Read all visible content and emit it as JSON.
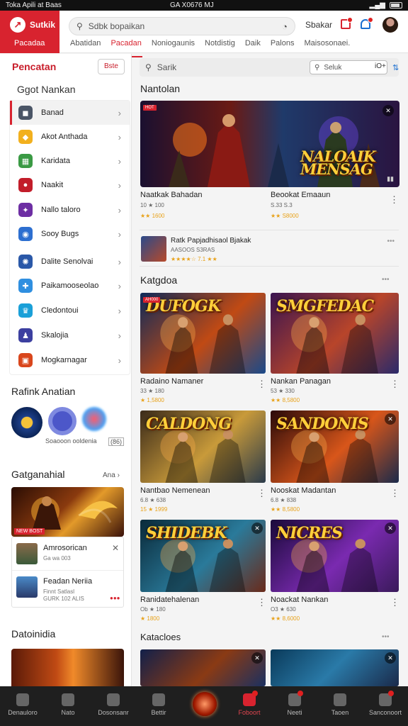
{
  "status": {
    "left": "Toka Apili at Baas",
    "center": "GA X0676 MJ",
    "right": "ML"
  },
  "header": {
    "brand": "Sutkik",
    "brand_sub": "Pacadaa",
    "search": "Sdbk bopaikan",
    "link": "Sbakar",
    "tabs": [
      "Abatidan",
      "Pacadan",
      "Noniogaunis",
      "Notdistig",
      "Daik",
      "Palons",
      "Maisosonaei."
    ]
  },
  "sidebar": {
    "title": "Pencatan",
    "button": "Bste",
    "section": "Ggot Nankan",
    "items": [
      {
        "label": "Banad",
        "color": "#4a5566",
        "icon": "◼"
      },
      {
        "label": "Akot Anthada",
        "color": "#f2b01e",
        "icon": "◆"
      },
      {
        "label": "Karidata",
        "color": "#3a9a44",
        "icon": "▦"
      },
      {
        "label": "Naakit",
        "color": "#c21d2a",
        "icon": "●"
      },
      {
        "label": "Nallo taloro",
        "color": "#6d2ea3",
        "icon": "✦"
      },
      {
        "label": "Sooy Bugs",
        "color": "#2d6fd0",
        "icon": "◉"
      },
      {
        "label": "Dalite Senolvai",
        "color": "#2a58a8",
        "icon": "✺"
      },
      {
        "label": "Paikamooseolao",
        "color": "#2f8fe0",
        "icon": "✚"
      },
      {
        "label": "Cledontoui",
        "color": "#1aa0d8",
        "icon": "♛"
      },
      {
        "label": "Skalojia",
        "color": "#3c3fa0",
        "icon": "♟"
      },
      {
        "label": "Mogkarnagar",
        "color": "#d9461c",
        "icon": "▣"
      }
    ],
    "ranking_title": "Rafink Anatian",
    "ranking_caption": "Soaooon ooldenia",
    "ranking_count": "(86)",
    "groups_title": "Gatganahial",
    "groups_more": "Ana",
    "promo_badge": "NEW BOST",
    "recs": [
      {
        "name": "Amrosorican",
        "sub": "Ga wa 003"
      },
      {
        "name": "Feadan Neriia",
        "sub": "Finnt Satlasl",
        "sub2": "GURK 102 ALIS"
      }
    ],
    "last_title": "Datoinidia"
  },
  "main": {
    "search": "Sarik",
    "search_inner": "Seluk",
    "search_opt": "iO+",
    "section1": "Nantolan",
    "banner_title": "NALOAIK\nMENSAG",
    "featured": [
      {
        "title": "Naatkak Bahadan",
        "sub": "10 ★ 100",
        "sub2": "★★ 1600"
      },
      {
        "title": "Beookat Emaaun",
        "sub": "S.33 S.3",
        "sub2": "★★ S8000"
      }
    ],
    "wide_item": {
      "title": "Ratk Papjadhisaol Bjakak",
      "sub": "AASOOS S3RAS",
      "rating": "★★★★☆ 7.1 ★★"
    },
    "section2": "Katgdoa",
    "grid": [
      {
        "art_title": "DUFOGK",
        "title": "Radaino Namaner",
        "sub": "33 ★ 180",
        "sub2": "★ 1,5800",
        "badge": "AH000"
      },
      {
        "art_title": "SMGFEDAC",
        "title": "Nankan Panagan",
        "sub": "53 ★ 330",
        "sub2": "★★ 8,5800"
      },
      {
        "art_title": "CALDONG",
        "title": "Nantbao Nemenean",
        "sub": "6.8 ★ 638",
        "sub2": "15 ★ 1999"
      },
      {
        "art_title": "SANDONIS",
        "title": "Nooskat Madantan",
        "sub": "6.8 ★ 838",
        "sub2": "★★ 8,5800"
      },
      {
        "art_title": "SHIDEBK",
        "title": "Ranidatehalenan",
        "sub": "Ob ★ 180",
        "sub2": "★ 1800"
      },
      {
        "art_title": "NICRES",
        "title": "Noackat Nankan",
        "sub": "O3 ★ 630",
        "sub2": "★★ 8,6000"
      }
    ],
    "section3": "Katacloes"
  },
  "bottom_nav": [
    "Denauloro",
    "Nato",
    "Dosonsanr",
    "Bettir",
    "",
    "Foboort",
    "Neeti",
    "Taoen",
    "Sanconoort"
  ],
  "colors": {
    "brand": "#d8232f",
    "accent_blue": "#1a6fd0"
  }
}
